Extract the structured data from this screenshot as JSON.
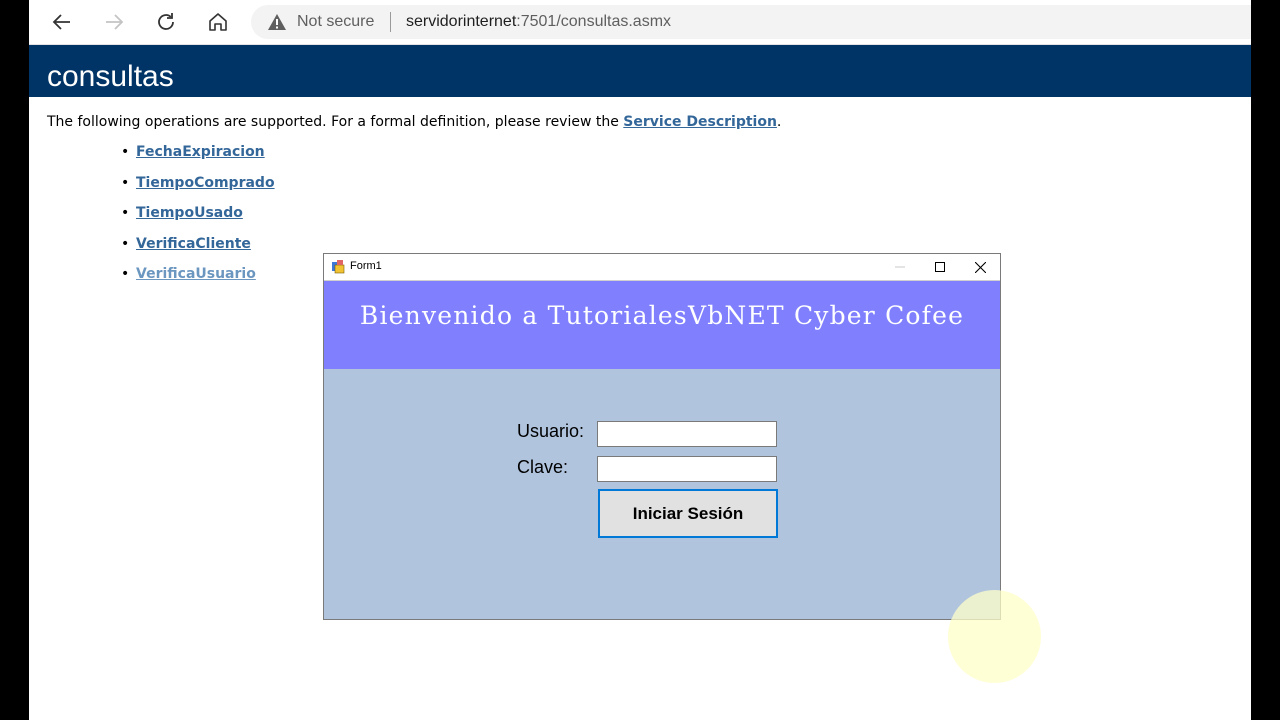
{
  "browser": {
    "security_label": "Not secure",
    "url_host": "servidorinternet",
    "url_rest": ":7501/consultas.asmx"
  },
  "page": {
    "title": "consultas",
    "intro_prefix": "The following operations are supported. For a formal definition, please review the ",
    "intro_link": "Service Description",
    "intro_suffix": ".",
    "operations": [
      "FechaExpiracion",
      "TiempoComprado",
      "TiempoUsado",
      "VerificaCliente",
      "VerificaUsuario"
    ]
  },
  "form": {
    "title": "Form1",
    "banner": "Bienvenido a TutorialesVbNET Cyber Cofee",
    "user_label": "Usuario:",
    "password_label": "Clave:",
    "user_value": "",
    "password_value": "",
    "login_button": "Iniciar Sesión"
  },
  "colors": {
    "header_bar": "#003366",
    "link": "#336699",
    "form_bg": "#b0c4de",
    "banner_bg": "#8080ff",
    "button_border": "#0078d7"
  }
}
